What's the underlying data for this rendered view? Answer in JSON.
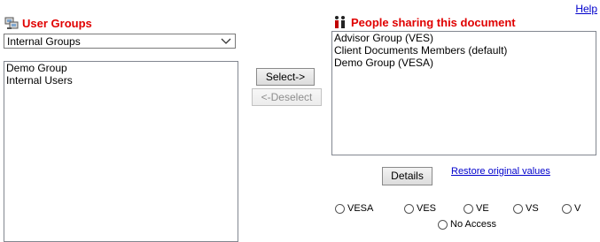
{
  "help_label": "Help",
  "user_groups": {
    "title": "User Groups",
    "selected_filter": "Internal Groups",
    "items": [
      "Demo Group",
      "Internal Users"
    ]
  },
  "actions": {
    "select_label": "Select->",
    "deselect_label": "<-Deselect"
  },
  "sharing": {
    "title": "People sharing this document",
    "items": [
      "Advisor Group (VES)",
      "Client Documents Members (default)",
      "Demo Group (VESA)"
    ]
  },
  "details_label": "Details",
  "restore_label": "Restore original values",
  "access_options": [
    "VESA",
    "VES",
    "VE",
    "VS",
    "V",
    "No Access"
  ]
}
